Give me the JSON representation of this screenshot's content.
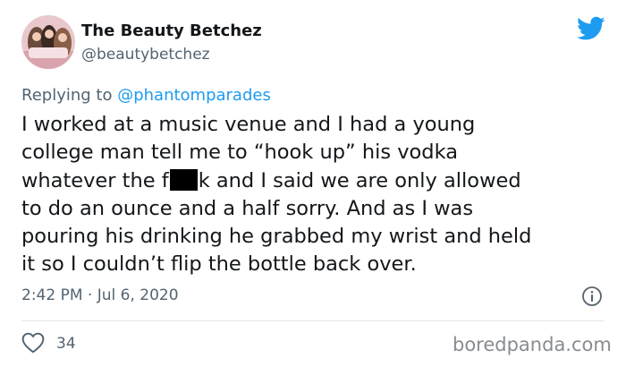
{
  "tweet": {
    "author_name": "The Beauty Betchez",
    "author_handle": "@beautybetchez",
    "replying_prefix": "Replying to ",
    "replying_to": "@phantomparades",
    "body_lines": [
      "I worked at a music venue and I had a young",
      "college man tell me to “hook up” his vodka",
      "whatever the f",
      "k and I said we are only allowed",
      "to do an ounce and a half sorry. And as I was",
      "pouring his drinking he grabbed my wrist and held",
      "it so I couldn’t flip the bottle back over."
    ],
    "timestamp": "2:42 PM · Jul 6, 2020",
    "like_count": "34"
  },
  "icons": {
    "avatar": "profile-photo",
    "brand": "twitter-bird-icon",
    "info": "info-icon",
    "like": "heart-icon"
  },
  "watermark": "boredpanda.com",
  "colors": {
    "twitter_blue": "#1d9bf0",
    "secondary_text": "#536471",
    "primary_text": "#14171a",
    "divider": "#e1e8ed"
  }
}
